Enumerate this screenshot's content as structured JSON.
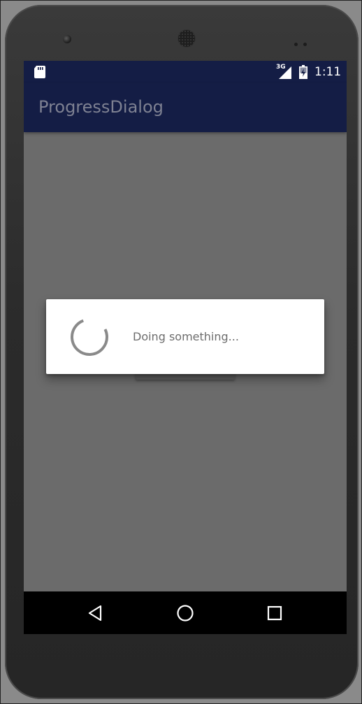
{
  "status_bar": {
    "network": "3G",
    "time": "1:11",
    "background": "#141d45"
  },
  "app_bar": {
    "title": "ProgressDialog",
    "background": "#141d45"
  },
  "dialog": {
    "message": "Doing something...",
    "spinner_icon": "circular-progress-spinner"
  },
  "nav_bar": {
    "buttons": [
      "back-icon",
      "home-icon",
      "recents-icon"
    ]
  },
  "colors": {
    "scrim": "#6b6b6b",
    "dialog_bg": "#ffffff",
    "message_text": "#6d6d6d",
    "title_text": "#7e8192",
    "spinner": "#8a8a8a"
  }
}
